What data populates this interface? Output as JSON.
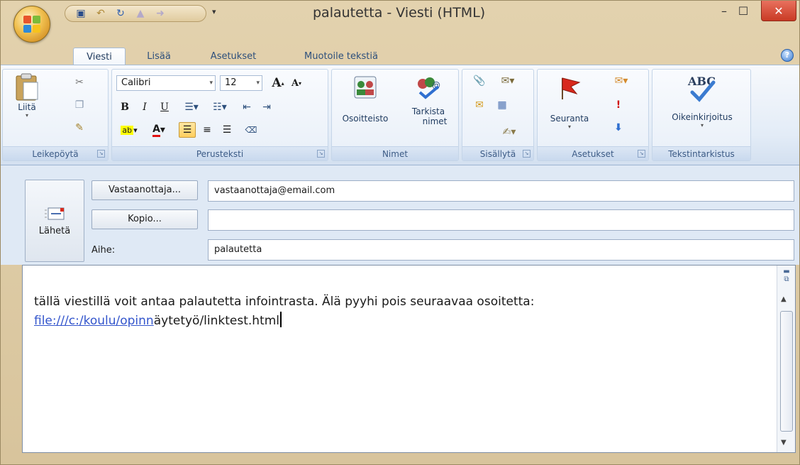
{
  "window": {
    "title": "palautetta - Viesti (HTML)",
    "minimize": "–",
    "maximize": "☐",
    "close": "✕",
    "qat_more": "▾"
  },
  "tabs": [
    {
      "label": "Viesti",
      "active": true
    },
    {
      "label": "Lisää",
      "active": false
    },
    {
      "label": "Asetukset",
      "active": false
    },
    {
      "label": "Muotoile tekstiä",
      "active": false
    }
  ],
  "ribbon": {
    "groups": {
      "clipboard": "Leikepöytä",
      "basic_text": "Perusteksti",
      "names": "Nimet",
      "include": "Sisällytä",
      "options": "Asetukset",
      "proofing": "Tekstintarkistus"
    },
    "paste_label": "Liitä",
    "font_name": "Calibri",
    "font_size": "12",
    "address_book_label": "Osoitteisto",
    "check_names_label_1": "Tarkista",
    "check_names_label_2": "nimet",
    "follow_up_label": "Seuranta",
    "spelling_label": "Oikeinkirjoitus",
    "spelling_icon_text": "ABC",
    "bold": "B",
    "italic": "I",
    "underline": "U",
    "grow_font": "A",
    "shrink_font": "A"
  },
  "header": {
    "send_label": "Lähetä",
    "to_button": "Vastaanottaja...",
    "cc_button": "Kopio...",
    "subject_label": "Aihe:",
    "to_value": "vastaanottaja@email.com",
    "cc_value": "",
    "subject_value": "palautetta"
  },
  "body": {
    "line1": "tällä viestillä voit antaa palautetta infointrasta. Älä pyyhi pois seuraavaa osoitetta:",
    "link_text": "file:///c:/koulu/opinn",
    "line2_rest": "äytetyö/linktest.html"
  },
  "colors": {
    "accent_blue": "#2d4f7c",
    "link": "#3355cc",
    "close_red": "#c93a24"
  }
}
